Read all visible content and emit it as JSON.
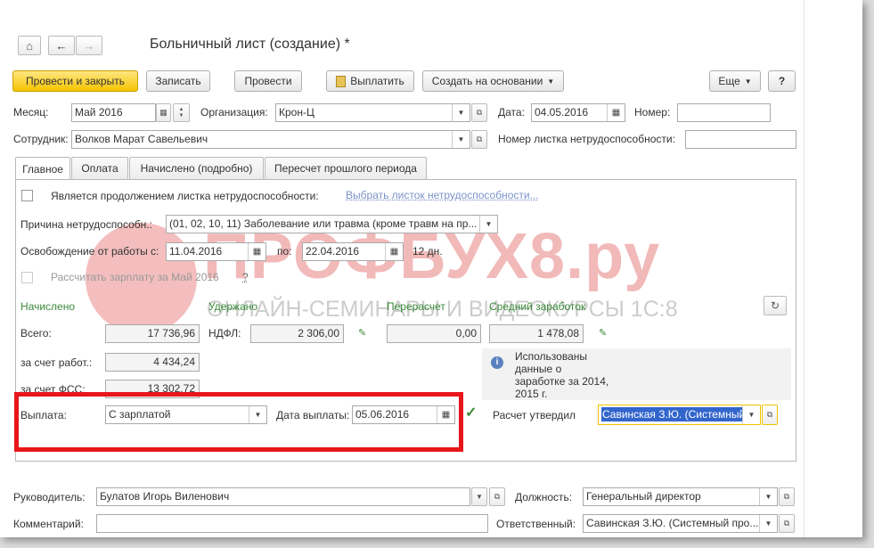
{
  "window": {
    "title": "Больничный лист (создание) *"
  },
  "nav": {
    "home_icon": "home-icon",
    "back_icon": "arrow-left-icon",
    "forward_icon": "arrow-right-icon"
  },
  "toolbar": {
    "post_close": "Провести и закрыть",
    "write": "Записать",
    "post": "Провести",
    "pay": "Выплатить",
    "create_based": "Создать на основании",
    "more": "Еще",
    "help": "?"
  },
  "header": {
    "month_label": "Месяц:",
    "month_value": "Май 2016",
    "org_label": "Организация:",
    "org_value": "Крон-Ц",
    "date_label": "Дата:",
    "date_value": "04.05.2016",
    "number_label": "Номер:",
    "number_value": "",
    "employee_label": "Сотрудник:",
    "employee_value": "Волков Марат Савельевич",
    "sheet_number_label": "Номер листка нетрудоспособности:",
    "sheet_number_value": ""
  },
  "tabs": [
    "Главное",
    "Оплата",
    "Начислено (подробно)",
    "Пересчет прошлого периода"
  ],
  "main": {
    "continuation_label": "Является продолжением листка нетрудоспособности:",
    "continuation_link": "Выбрать листок нетрудоспособности...",
    "reason_label": "Причина нетрудоспособн.:",
    "reason_value": "(01, 02, 10, 11) Заболевание или травма (кроме травм на пр...",
    "release_label": "Освобождение от работы с:",
    "release_from": "11.04.2016",
    "release_to_label": "по:",
    "release_to": "22.04.2016",
    "days": "12 дн.",
    "recalc_label": "Рассчитать зарплату за Май 2016",
    "recalc_help": "?"
  },
  "summary": {
    "accrued_header": "Начислено",
    "withheld_header": "Удержано",
    "recalc_header": "Перерасчет",
    "avg_header": "Средний заработок",
    "total_label": "Всего:",
    "total_value": "17 736,96",
    "ndfl_label": "НДФЛ:",
    "ndfl_value": "2 306,00",
    "recalc_value": "0,00",
    "avg_value": "1 478,08",
    "employer_label": "за счет работ.:",
    "employer_value": "4 434,24",
    "fss_label": "за счет ФСС:",
    "fss_value": "13 302,72",
    "info_text": [
      "Использованы",
      "данные о",
      "заработке за 2014,",
      "2015 г."
    ]
  },
  "payment": {
    "payout_label": "Выплата:",
    "payout_value": "С зарплатой",
    "payout_date_label": "Дата выплаты:",
    "payout_date_value": "05.06.2016",
    "approved_label": "Расчет утвердил",
    "approved_value": "Савинская З.Ю. (Системный"
  },
  "footer": {
    "manager_label": "Руководитель:",
    "manager_value": "Булатов Игорь Виленович",
    "position_label": "Должность:",
    "position_value": "Генеральный директор",
    "comment_label": "Комментарий:",
    "comment_value": "",
    "responsible_label": "Ответственный:",
    "responsible_value": "Савинская З.Ю. (Системный про..."
  },
  "watermark": {
    "brand": "ПРОФБУХ8.ру",
    "tagline": "ОНЛАЙН-СЕМИНАРЫ И ВИДЕОКУРСЫ 1С:8"
  },
  "colors": {
    "accent_yellow": "#f5c400",
    "highlight_red": "#e8161b",
    "label_green": "#3a8a3a",
    "link": "#7b93c9"
  }
}
